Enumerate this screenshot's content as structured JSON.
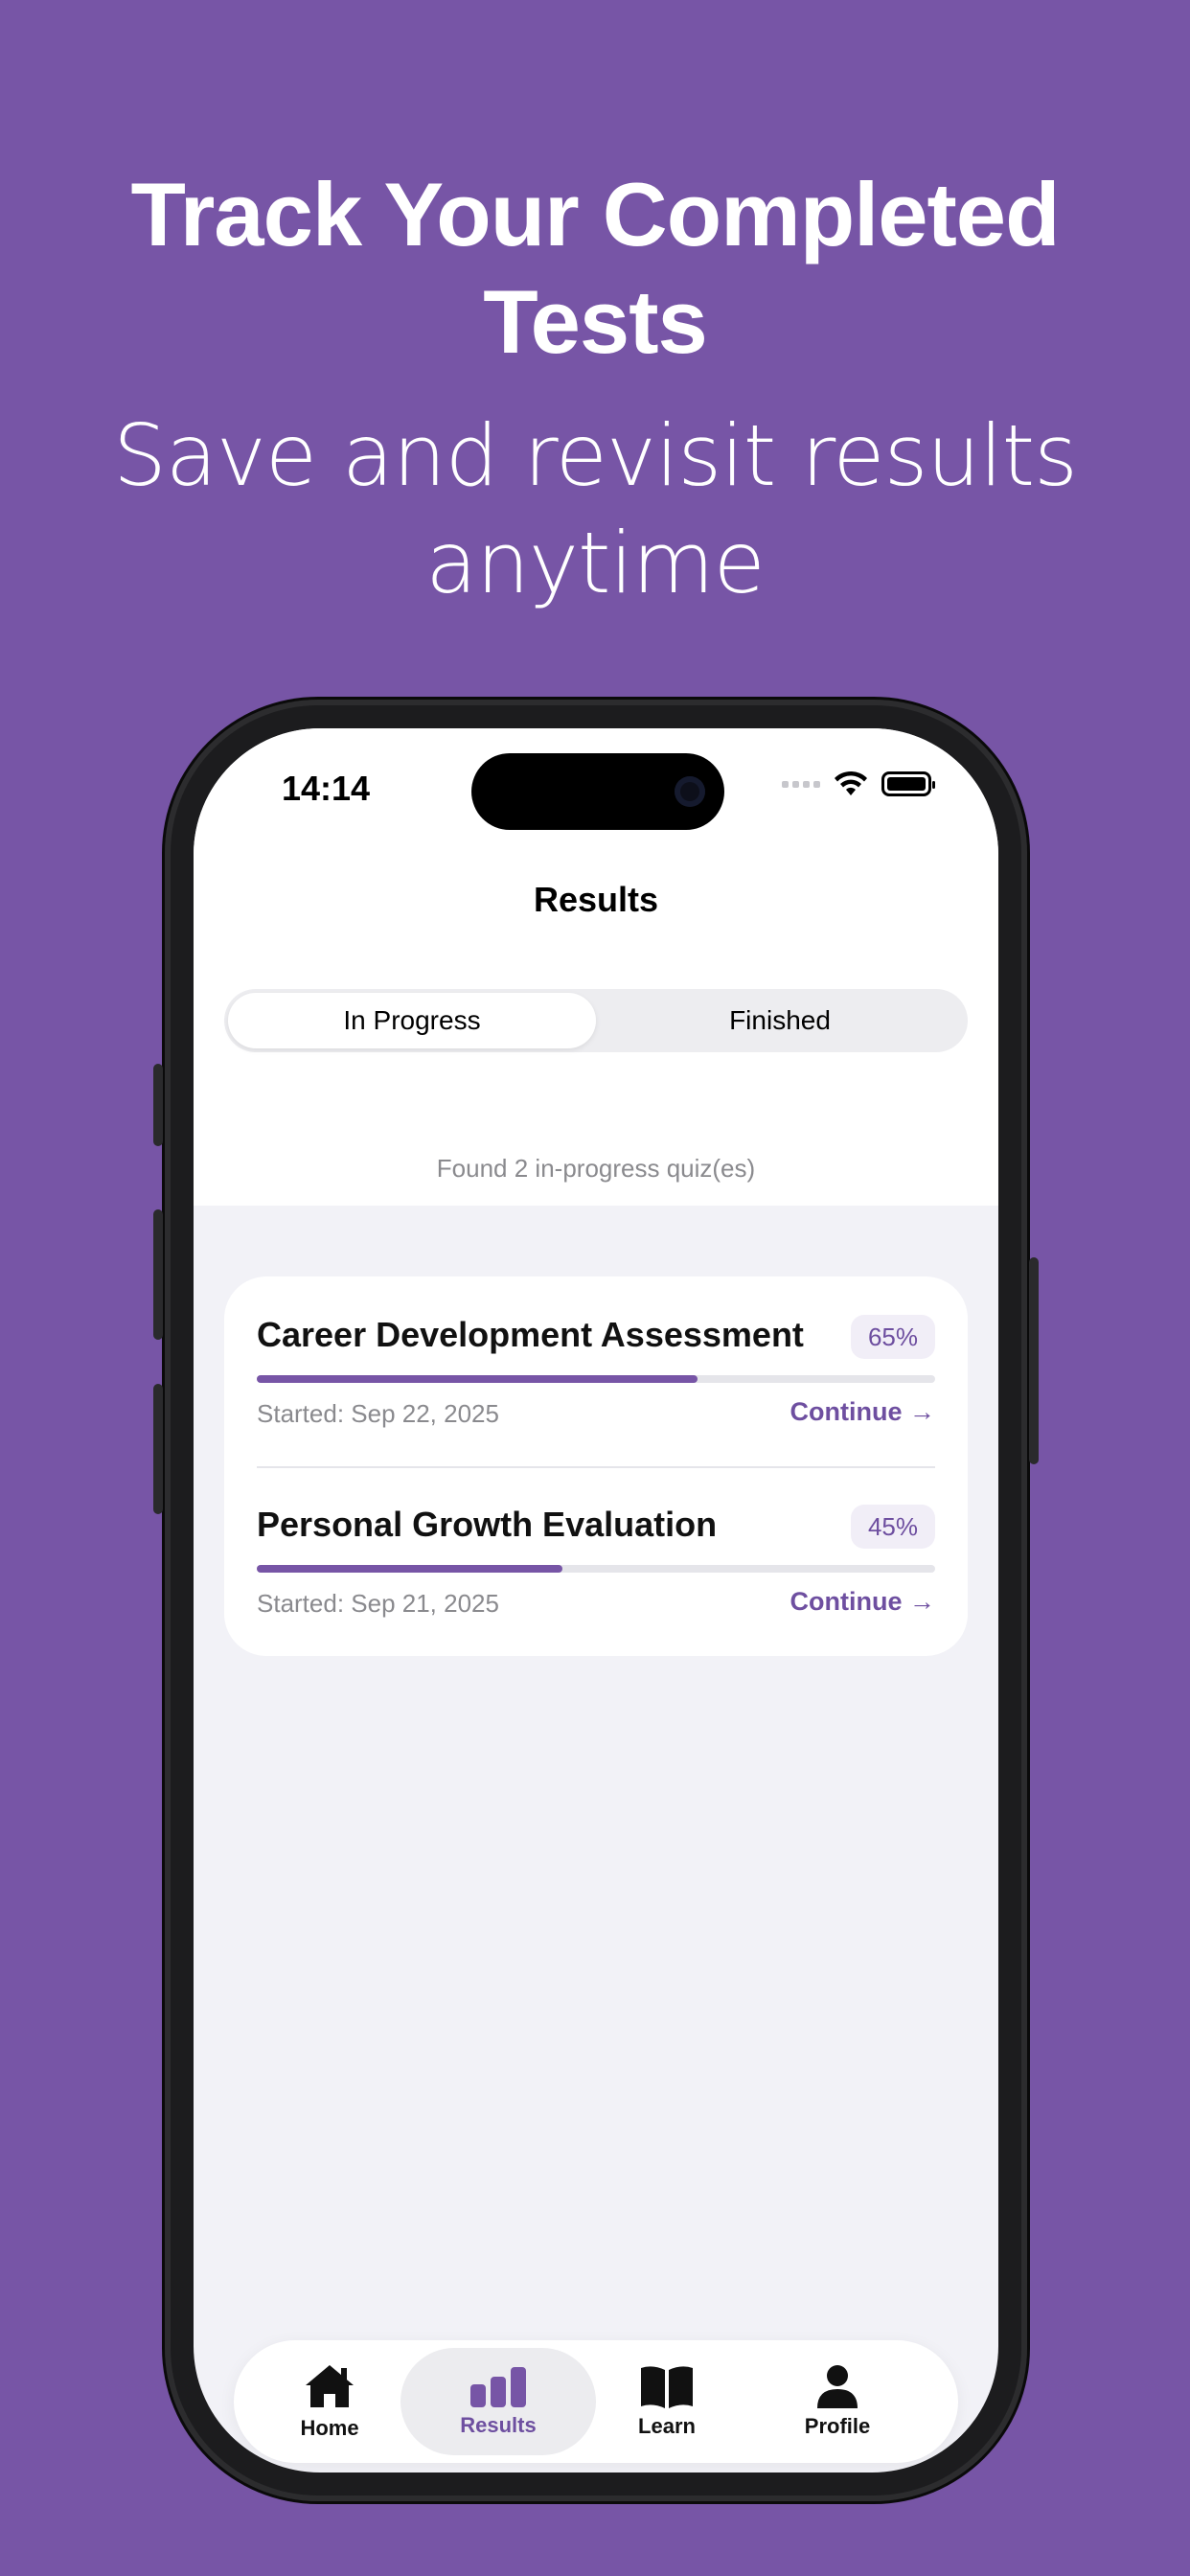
{
  "marketing": {
    "headline_line1": "Track Your Completed",
    "headline_line2": "Tests",
    "subline_line1": "Save and revisit results",
    "subline_line2": "anytime"
  },
  "status_bar": {
    "time": "14:14"
  },
  "nav": {
    "title": "Results"
  },
  "segments": {
    "in_progress": "In Progress",
    "finished": "Finished",
    "selected": "In Progress"
  },
  "summary": {
    "found_text": "Found 2 in-progress quiz(es)"
  },
  "quizzes": [
    {
      "title": "Career Development Assessment",
      "percent_label": "65%",
      "progress": 0.65,
      "started": "Started: Sep 22, 2025",
      "action": "Continue →"
    },
    {
      "title": "Personal Growth Evaluation",
      "percent_label": "45%",
      "progress": 0.45,
      "started": "Started: Sep 21, 2025",
      "action": "Continue →"
    }
  ],
  "tabbar": {
    "home": "Home",
    "results": "Results",
    "learn": "Learn",
    "profile": "Profile",
    "selected": "Results"
  },
  "colors": {
    "brand": "#7755A6",
    "accent_text": "#6E4FA0"
  }
}
